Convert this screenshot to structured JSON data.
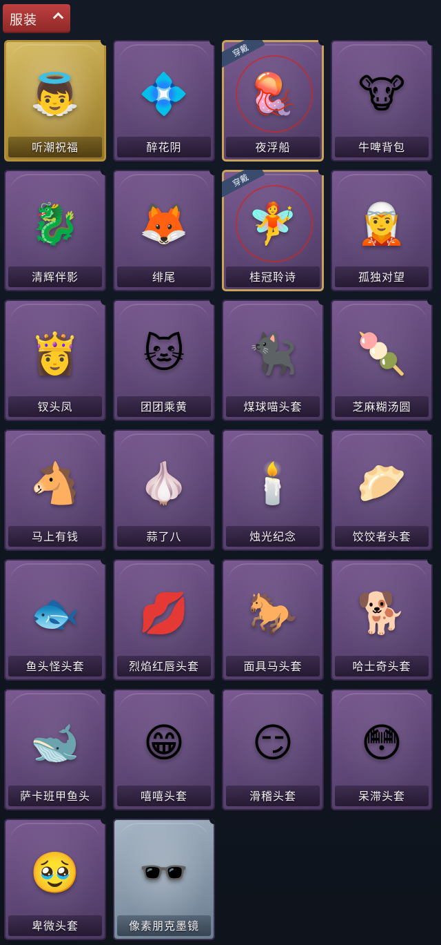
{
  "section": {
    "title": "服装",
    "expanded": true
  },
  "equipped_badge": "穿戴",
  "items": [
    {
      "name": "听潮祝福",
      "icon": "angel-doll-icon",
      "glyph": "👼",
      "rarity": "gold"
    },
    {
      "name": "醉花阴",
      "icon": "jeweled-ornament-icon",
      "glyph": "💠",
      "rarity": "purple"
    },
    {
      "name": "夜浮船",
      "icon": "crystal-jellyfish-icon",
      "glyph": "🪼",
      "rarity": "purple",
      "equipped": true
    },
    {
      "name": "牛啤背包",
      "icon": "cow-beer-barrel-icon",
      "glyph": "🐮",
      "rarity": "purple"
    },
    {
      "name": "清辉伴影",
      "icon": "white-dragon-charm-icon",
      "glyph": "🐉",
      "rarity": "purple"
    },
    {
      "name": "绯尾",
      "icon": "fox-girl-charm-icon",
      "glyph": "🦊",
      "rarity": "purple"
    },
    {
      "name": "桂冠聆诗",
      "icon": "laurel-poet-charm-icon",
      "glyph": "🧚",
      "rarity": "purple",
      "equipped": true
    },
    {
      "name": "孤独对望",
      "icon": "lonely-gaze-charm-icon",
      "glyph": "🧝",
      "rarity": "purple"
    },
    {
      "name": "钗头凤",
      "icon": "phoenix-crown-doll-icon",
      "glyph": "👸",
      "rarity": "purple"
    },
    {
      "name": "团团乘黄",
      "icon": "round-yellow-beast-icon",
      "glyph": "🐱",
      "rarity": "purple"
    },
    {
      "name": "煤球喵头套",
      "icon": "black-cat-head-icon",
      "glyph": "🐈‍⬛",
      "rarity": "purple"
    },
    {
      "name": "芝麻糊汤圆",
      "icon": "rice-ball-head-icon",
      "glyph": "🍡",
      "rarity": "purple"
    },
    {
      "name": "马上有钱",
      "icon": "red-horse-head-icon",
      "glyph": "🐴",
      "rarity": "purple"
    },
    {
      "name": "蒜了八",
      "icon": "garlic-head-icon",
      "glyph": "🧄",
      "rarity": "purple"
    },
    {
      "name": "烛光纪念",
      "icon": "candle-head-icon",
      "glyph": "🕯️",
      "rarity": "purple"
    },
    {
      "name": "饺饺者头套",
      "icon": "dumpling-head-icon",
      "glyph": "🥟",
      "rarity": "purple"
    },
    {
      "name": "鱼头怪头套",
      "icon": "fish-monster-head-icon",
      "glyph": "🐟",
      "rarity": "purple"
    },
    {
      "name": "烈焰红唇头套",
      "icon": "red-lips-pikachu-head-icon",
      "glyph": "💋",
      "rarity": "purple"
    },
    {
      "name": "面具马头套",
      "icon": "horse-mask-head-icon",
      "glyph": "🐎",
      "rarity": "purple"
    },
    {
      "name": "哈士奇头套",
      "icon": "husky-head-icon",
      "glyph": "🐕",
      "rarity": "purple"
    },
    {
      "name": "萨卡班甲鱼头",
      "icon": "sacabambaspis-head-icon",
      "glyph": "🐋",
      "rarity": "purple"
    },
    {
      "name": "嘻嘻头套",
      "icon": "grinning-emoji-head-icon",
      "glyph": "😁",
      "rarity": "purple"
    },
    {
      "name": "滑稽头套",
      "icon": "smirk-emoji-head-icon",
      "glyph": "😏",
      "rarity": "purple"
    },
    {
      "name": "呆滞头套",
      "icon": "dazed-emoji-head-icon",
      "glyph": "😳",
      "rarity": "purple"
    },
    {
      "name": "卑微头套",
      "icon": "humble-emoji-head-icon",
      "glyph": "🥹",
      "rarity": "purple"
    },
    {
      "name": "像素朋克墨镜",
      "icon": "pixel-sunglasses-icon",
      "glyph": "🕶️",
      "rarity": "silver"
    }
  ]
}
